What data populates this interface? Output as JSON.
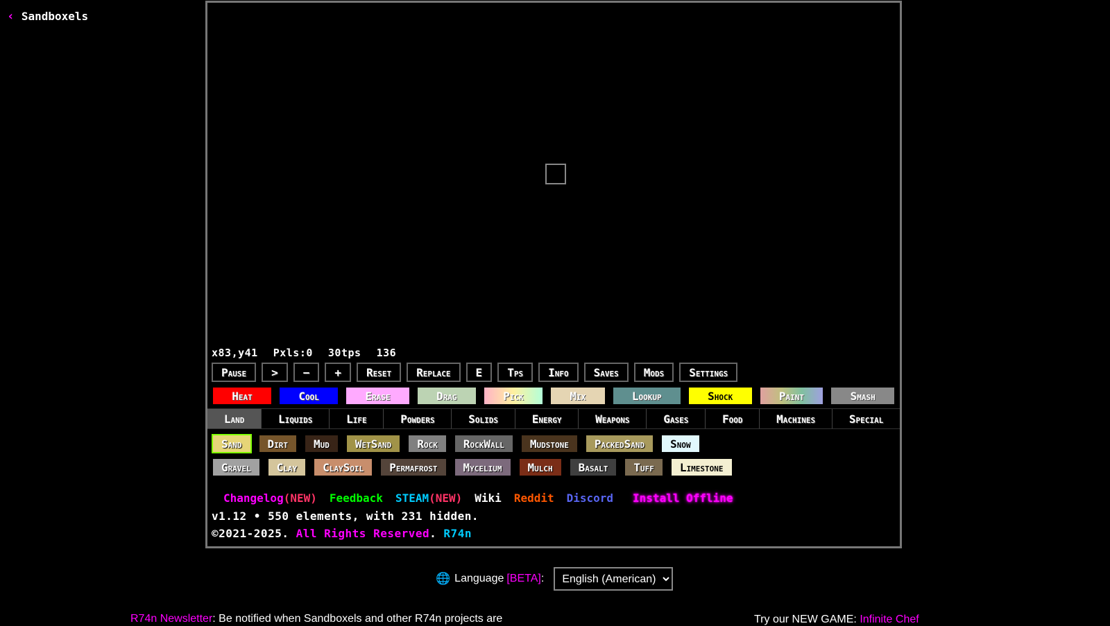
{
  "nav": {
    "back_icon": "chevron-left-icon",
    "title": "Sandboxels"
  },
  "stats": {
    "coords": "x83,y41",
    "pixels": "Pxls:0",
    "tps": "30tps",
    "frame": "136"
  },
  "controls": [
    "Pause",
    ">",
    "−",
    "+",
    "Reset",
    "Replace",
    "E",
    "Tps",
    "Info",
    "Saves",
    "Mods",
    "Settings"
  ],
  "tools": [
    {
      "label": "Heat",
      "color": "#ff0000"
    },
    {
      "label": "Cool",
      "color": "#0000ff"
    },
    {
      "label": "Erase",
      "color": "#ffaaff"
    },
    {
      "label": "Drag",
      "color": "#bcd3b3"
    },
    {
      "label": "Pick",
      "color": "#ffbbcc"
    },
    {
      "label": "Mix",
      "color": "#e5d5b3"
    },
    {
      "label": "Lookup",
      "color": "#5f8f8f"
    },
    {
      "label": "Shock",
      "color": "#ffff00"
    },
    {
      "label": "Paint",
      "color": "#c0c0a0"
    },
    {
      "label": "Smash",
      "color": "#888888"
    }
  ],
  "categories": [
    "Land",
    "Liquids",
    "Life",
    "Powders",
    "Solids",
    "Energy",
    "Weapons",
    "Gases",
    "Food",
    "Machines",
    "Special"
  ],
  "active_category": "Land",
  "elements": [
    [
      {
        "label": "Sand",
        "color": "#e6d577",
        "selected": true
      },
      {
        "label": "Dirt",
        "color": "#76552b"
      },
      {
        "label": "Mud",
        "color": "#382417"
      },
      {
        "label": "WetSand",
        "color": "#a19348"
      },
      {
        "label": "Rock",
        "color": "#808080"
      },
      {
        "label": "RockWall",
        "color": "#666666"
      },
      {
        "label": "Mudstone",
        "color": "#4a341e"
      },
      {
        "label": "PackedSand",
        "color": "#a89a5d"
      },
      {
        "label": "Snow",
        "color": "#e1f8fc",
        "dark": true
      }
    ],
    [
      {
        "label": "Gravel",
        "color": "#a1a1a1"
      },
      {
        "label": "Clay",
        "color": "#d4c59c"
      },
      {
        "label": "ClaySoil",
        "color": "#c88e6c"
      },
      {
        "label": "Permafrost",
        "color": "#54443a"
      },
      {
        "label": "Mycelium",
        "color": "#7c6a7c"
      },
      {
        "label": "Mulch",
        "color": "#7a2d17"
      },
      {
        "label": "Basalt",
        "color": "#3f3f3f"
      },
      {
        "label": "Tuff",
        "color": "#7a6a50"
      },
      {
        "label": "Limestone",
        "color": "#f4efd1",
        "dark": true
      }
    ]
  ],
  "links": [
    {
      "label": "Changelog",
      "color": "#ff00ff",
      "suffix": "(NEW)",
      "suffix_color": "#ff3366"
    },
    {
      "label": "Feedback",
      "color": "#00ff00"
    },
    {
      "label": "STEAM",
      "color": "#00ccff",
      "suffix": "(NEW)",
      "suffix_color": "#ff3366"
    },
    {
      "label": "Wiki",
      "color": "#ffffff"
    },
    {
      "label": "Reddit",
      "color": "#ff5700"
    },
    {
      "label": "Discord",
      "color": "#5865f2"
    },
    {
      "label": "Install Offline",
      "color": "#ff00ff",
      "glow": true
    }
  ],
  "version": "v1.12 • 550 elements, with 231 hidden.",
  "copyright": {
    "prefix": "©2021-2025.",
    "rights": "All Rights Reserved",
    "dot": ".",
    "author": "R74n"
  },
  "language": {
    "icon": "globe-icon",
    "label": "Language",
    "beta": "[BETA]",
    "colon": ":",
    "selected": "English (American)"
  },
  "footer": {
    "newsletter_link": "R74n Newsletter",
    "newsletter_text": ": Be notified when Sandboxels and other R74n projects are",
    "new_game_text": "Try our NEW GAME: ",
    "new_game_link": "Infinite Chef"
  },
  "colors": {
    "accent": "#ff00ff",
    "cyan": "#00ccff"
  }
}
